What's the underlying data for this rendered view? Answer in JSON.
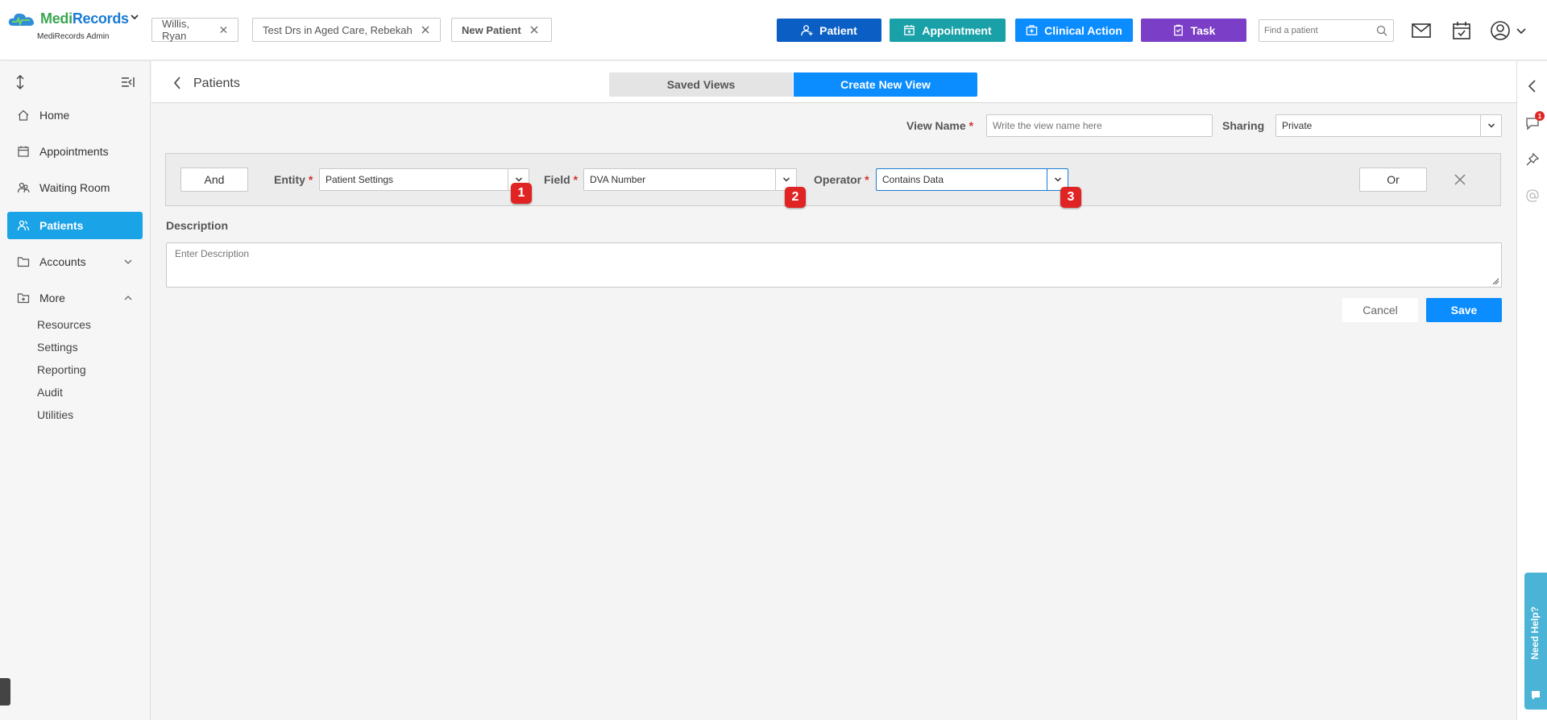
{
  "app": {
    "brand_a": "Medi",
    "brand_b": "Records",
    "subtitle": "MediRecords Admin"
  },
  "open_tabs": [
    {
      "label": "Willis, Ryan"
    },
    {
      "label": "Test Drs in Aged Care, Rebekah"
    },
    {
      "label": "New Patient"
    }
  ],
  "toolbar": {
    "patient_label": "Patient",
    "appointment_label": "Appointment",
    "clinical_action_label": "Clinical Action",
    "task_label": "Task",
    "search_placeholder": "Find a patient",
    "colors": {
      "patient": "#0b5fc4",
      "appointment": "#1aa1a8",
      "clinical_action": "#0b8cff",
      "task": "#7b3fc7"
    }
  },
  "sidebar": {
    "items": [
      {
        "label": "Home",
        "icon": "home-icon"
      },
      {
        "label": "Appointments",
        "icon": "calendar-icon"
      },
      {
        "label": "Waiting Room",
        "icon": "people-icon"
      },
      {
        "label": "Patients",
        "icon": "patients-icon",
        "active": true
      },
      {
        "label": "Accounts",
        "icon": "folder-icon"
      },
      {
        "label": "More",
        "icon": "folder-plus-icon"
      }
    ],
    "sub_items": [
      "Resources",
      "Settings",
      "Reporting",
      "Audit",
      "Utilities"
    ]
  },
  "page": {
    "title": "Patients",
    "seg_saved": "Saved Views",
    "seg_new": "Create New View"
  },
  "form": {
    "view_name_label": "View Name",
    "view_name_placeholder": "Write the view name here",
    "sharing_label": "Sharing",
    "sharing_value": "Private",
    "and_label": "And",
    "entity_label": "Entity",
    "entity_value": "Patient Settings",
    "field_label": "Field",
    "field_value": "DVA Number",
    "operator_label": "Operator",
    "operator_value": "Contains Data",
    "or_label": "Or",
    "description_label": "Description",
    "description_placeholder": "Enter Description",
    "cancel_label": "Cancel",
    "save_label": "Save",
    "badges": [
      "1",
      "2",
      "3"
    ]
  },
  "rail": {
    "notification_count": "1",
    "help_label": "Need Help?"
  }
}
